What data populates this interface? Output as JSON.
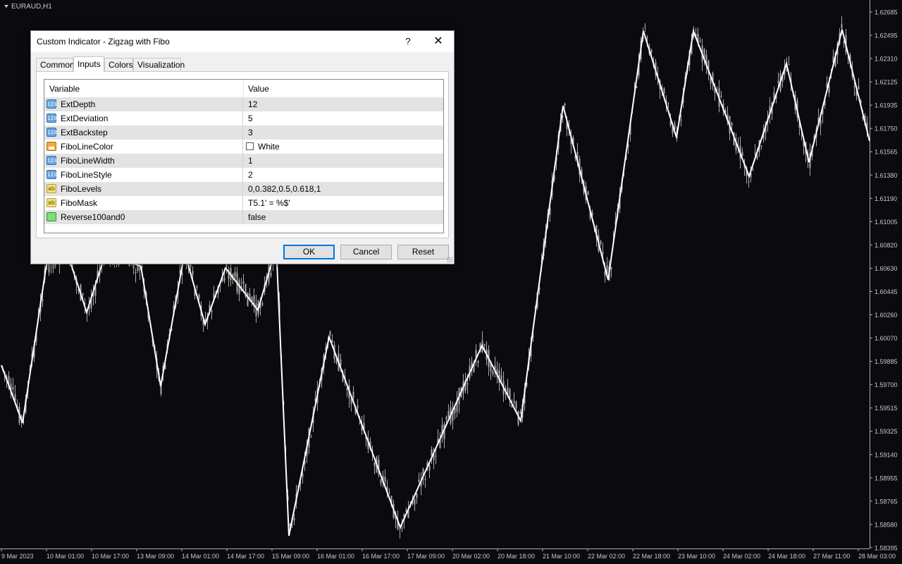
{
  "chart": {
    "symbol": "EURAUD,H1",
    "colors": {
      "background": "#0b0b0f",
      "candles": "#a8a8a8",
      "zigzag": "#ffffff",
      "axis_text": "#c8c8c8"
    },
    "price_labels": [
      "1.62685",
      "1.62495",
      "1.62310",
      "1.62125",
      "1.61935",
      "1.61750",
      "1.61565",
      "1.61380",
      "1.61190",
      "1.61005",
      "1.60820",
      "1.60630",
      "1.60445",
      "1.60260",
      "1.60070",
      "1.59885",
      "1.59700",
      "1.59515",
      "1.59325",
      "1.59140",
      "1.58955",
      "1.58765",
      "1.58580",
      "1.58395"
    ],
    "time_labels": [
      "9 Mar 2023",
      "10 Mar 01:00",
      "10 Mar 17:00",
      "13 Mar 09:00",
      "14 Mar 01:00",
      "14 Mar 17:00",
      "15 Mar 09:00",
      "16 Mar 01:00",
      "16 Mar 17:00",
      "17 Mar 09:00",
      "20 Mar 02:00",
      "20 Mar 18:00",
      "21 Mar 10:00",
      "22 Mar 02:00",
      "22 Mar 18:00",
      "23 Mar 10:00",
      "24 Mar 02:00",
      "24 Mar 18:00",
      "27 Mar 11:00",
      "28 Mar 03:00"
    ]
  },
  "dialog": {
    "title": "Custom Indicator - Zigzag with Fibo",
    "help_label": "?",
    "close_label": "✕",
    "tabs": [
      {
        "label": "Common"
      },
      {
        "label": "Inputs"
      },
      {
        "label": "Colors"
      },
      {
        "label": "Visualization"
      }
    ],
    "active_tab": "Inputs",
    "grid": {
      "header_variable": "Variable",
      "header_value": "Value",
      "rows": [
        {
          "icon": "int-icon",
          "variable": "ExtDepth",
          "value": "12"
        },
        {
          "icon": "int-icon",
          "variable": "ExtDeviation",
          "value": "5"
        },
        {
          "icon": "int-icon",
          "variable": "ExtBackstep",
          "value": "3"
        },
        {
          "icon": "color-icon",
          "variable": "FiboLineColor",
          "value": "White"
        },
        {
          "icon": "int-icon",
          "variable": "FiboLineWidth",
          "value": "1"
        },
        {
          "icon": "int-icon",
          "variable": "FiboLineStyle",
          "value": "2"
        },
        {
          "icon": "string-icon",
          "variable": "FiboLevels",
          "value": "0,0.382,0.5,0.618,1"
        },
        {
          "icon": "string-icon",
          "variable": "FiboMask",
          "value": "T5.1' = %$'"
        },
        {
          "icon": "bool-icon",
          "variable": "Reverse100and0",
          "value": "false"
        }
      ]
    },
    "buttons": {
      "ok": "OK",
      "cancel": "Cancel",
      "reset": "Reset"
    }
  }
}
